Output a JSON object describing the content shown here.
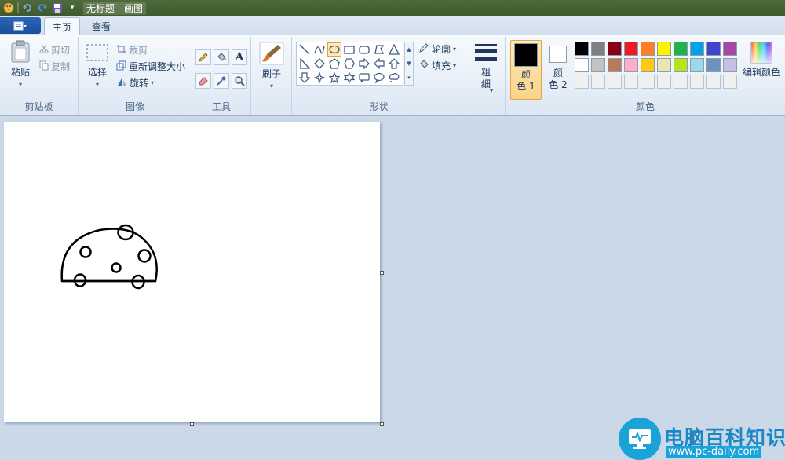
{
  "window": {
    "title": "无标题 - 画图"
  },
  "tabs": [
    {
      "label": "主页",
      "active": true
    },
    {
      "label": "查看",
      "active": false
    }
  ],
  "clipboard": {
    "paste": "粘贴",
    "cut": "剪切",
    "copy": "复制",
    "group": "剪贴板"
  },
  "image": {
    "select": "选择",
    "crop": "裁剪",
    "resize": "重新调整大小",
    "rotate": "旋转",
    "group": "图像"
  },
  "tools": {
    "group": "工具"
  },
  "brushes": {
    "label": "刷子"
  },
  "shapes": {
    "outline": "轮廓",
    "fill": "填充",
    "group": "形状",
    "items": [
      "line-icon",
      "curve-icon",
      "oval-icon",
      "rectangle-icon",
      "rounded-rectangle-icon",
      "polygon-icon",
      "triangle-icon",
      "right-triangle-icon",
      "diamond-icon",
      "pentagon-icon",
      "hexagon-icon",
      "right-arrow-icon",
      "left-arrow-icon",
      "up-arrow-icon",
      "down-arrow-icon",
      "four-point-star-icon",
      "five-point-star-icon",
      "six-point-star-icon",
      "rounded-callout-icon",
      "oval-callout-icon",
      "cloud-callout-icon"
    ],
    "selected": "oval-icon"
  },
  "size": {
    "label_line1": "粗",
    "label_line2": "细"
  },
  "colors": {
    "color1_line1": "颜",
    "color1_line2": "色 1",
    "color2_line1": "颜",
    "color2_line2": "色 2",
    "color1_value": "#000000",
    "color2_value": "#ffffff",
    "edit": "编辑颜色",
    "group": "颜色",
    "palette_row1": [
      "#000000",
      "#7f7f7f",
      "#880015",
      "#ed1c24",
      "#ff7f27",
      "#fff200",
      "#22b14c",
      "#00a2e8",
      "#3f48cc",
      "#a349a4"
    ],
    "palette_row2": [
      "#ffffff",
      "#c3c3c3",
      "#b97a57",
      "#ffaec9",
      "#ffc90e",
      "#efe4b0",
      "#b5e61d",
      "#99d9ea",
      "#7092be",
      "#c8bfe7"
    ],
    "palette_row3": [
      "#f0f0f0",
      "#f0f0f0",
      "#f0f0f0",
      "#f0f0f0",
      "#f0f0f0",
      "#f0f0f0",
      "#f0f0f0",
      "#f0f0f0",
      "#f0f0f0",
      "#f0f0f0"
    ]
  },
  "watermark": {
    "title": "电脑百科知识",
    "url": "www.pc-daily.com"
  }
}
